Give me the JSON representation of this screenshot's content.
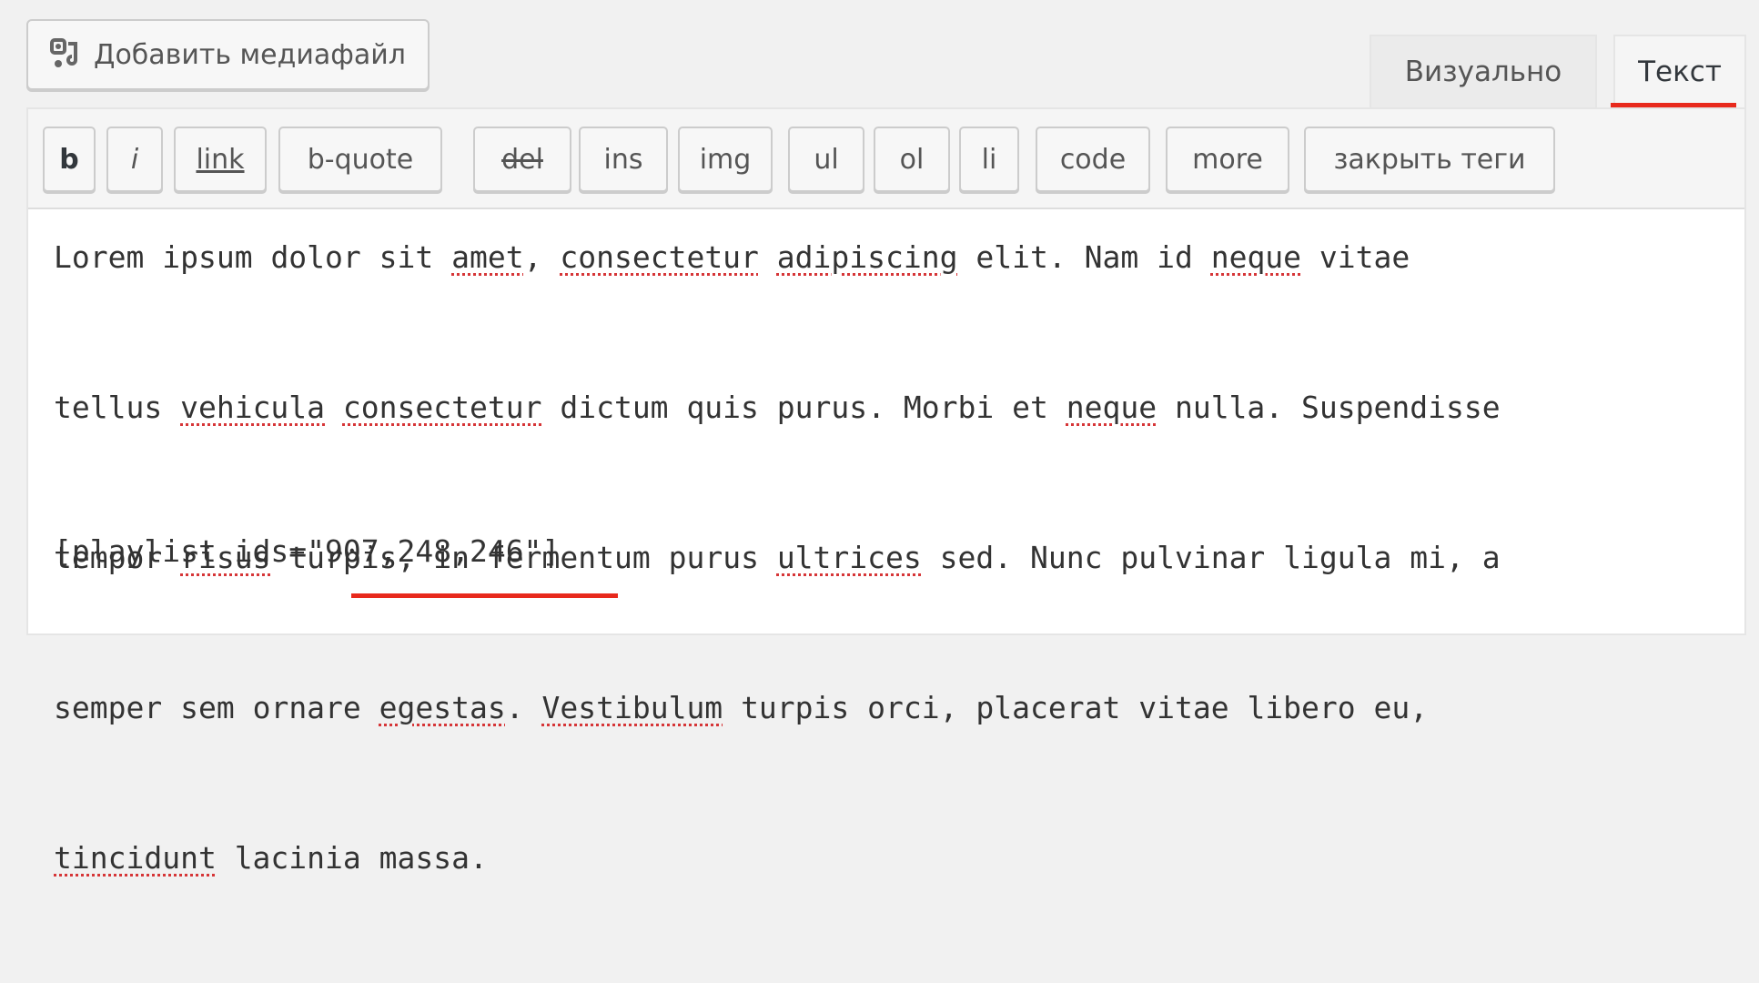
{
  "toolbar": {
    "add_media_label": "Добавить медиафайл",
    "add_media_icon": "media-add-icon"
  },
  "tabs": {
    "visual": "Визуально",
    "text": "Текст",
    "active": "text"
  },
  "quicktags": [
    {
      "id": "b",
      "label": "b"
    },
    {
      "id": "i",
      "label": "i"
    },
    {
      "id": "link",
      "label": "link"
    },
    {
      "id": "b-quote",
      "label": "b-quote"
    },
    {
      "id": "del",
      "label": "del"
    },
    {
      "id": "ins",
      "label": "ins"
    },
    {
      "id": "img",
      "label": "img"
    },
    {
      "id": "ul",
      "label": "ul"
    },
    {
      "id": "ol",
      "label": "ol"
    },
    {
      "id": "li",
      "label": "li"
    },
    {
      "id": "code",
      "label": "code"
    },
    {
      "id": "more",
      "label": "more"
    },
    {
      "id": "close",
      "label": "закрыть теги"
    }
  ],
  "content": {
    "paragraph_lines": [
      "Lorem ipsum dolor sit amet, consectetur adipiscing elit. Nam id neque vitae",
      "tellus vehicula consectetur dictum quis purus. Morbi et neque nulla. Suspendisse",
      "tempor risus turpis, in fermentum purus ultrices sed. Nunc pulvinar ligula mi, a",
      "semper sem ornare egestas. Vestibulum turpis orci, placerat vitae libero eu,",
      "tincidunt lacinia massa."
    ],
    "misspelled_words": [
      "amet",
      "consectetur",
      "adipiscing",
      "neque",
      "vehicula",
      "risus",
      "ultrices",
      "egestas",
      "Vestibulum",
      "tincidunt"
    ],
    "shortcode": "[playlist ids=\"907,248,246\"]"
  },
  "colors": {
    "accent_underline": "#e8291c",
    "spellcheck": "#d63638"
  }
}
